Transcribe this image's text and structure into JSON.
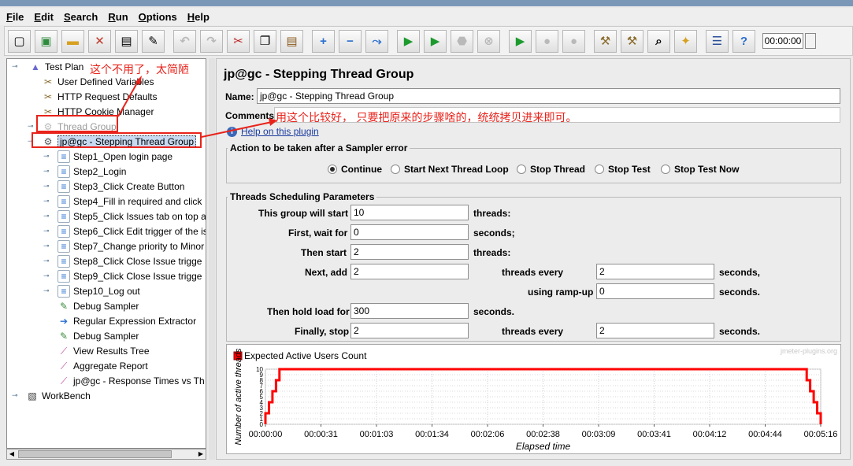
{
  "menu": [
    "File",
    "Edit",
    "Search",
    "Run",
    "Options",
    "Help"
  ],
  "toolbar": {
    "icons": [
      "new-icon",
      "templates-icon",
      "open-icon",
      "close-icon",
      "save-icon",
      "save-screenshot-icon",
      "undo-icon",
      "redo-icon",
      "cut-icon",
      "copy-icon",
      "paste-icon",
      "expand-icon",
      "collapse-icon",
      "toggle-icon",
      "start-icon",
      "start-no-pause-icon",
      "stop-icon",
      "shutdown-icon",
      "remote-start-icon",
      "remote-stop-icon",
      "remote-shutdown-icon",
      "clear-icon",
      "clear-all-icon",
      "search-icon",
      "reset-search-icon",
      "function-helper-icon",
      "help-icon"
    ],
    "timer": "00:00:00"
  },
  "tree": {
    "items": [
      {
        "label": "Test Plan",
        "icon": "test-plan-icon"
      },
      {
        "label": "User Defined Variables",
        "icon": "config-wrench-icon"
      },
      {
        "label": "HTTP Request Defaults",
        "icon": "config-wrench-icon"
      },
      {
        "label": "HTTP Cookie Manager",
        "icon": "config-wrench-icon"
      },
      {
        "label": "Thread Group",
        "icon": "thread-group-icon"
      },
      {
        "label": "jp@gc - Stepping Thread Group",
        "icon": "thread-group-icon"
      },
      {
        "label": "Step1_Open login page",
        "icon": "transaction-controller-icon"
      },
      {
        "label": "Step2_Login",
        "icon": "transaction-controller-icon"
      },
      {
        "label": "Step3_Click Create Button",
        "icon": "transaction-controller-icon"
      },
      {
        "label": "Step4_Fill in required and click",
        "icon": "transaction-controller-icon"
      },
      {
        "label": "Step5_Click Issues tab on top a",
        "icon": "transaction-controller-icon"
      },
      {
        "label": "Step6_Click Edit trigger of the is",
        "icon": "transaction-controller-icon"
      },
      {
        "label": "Step7_Change priority to Minor",
        "icon": "transaction-controller-icon"
      },
      {
        "label": "Step8_Click Close Issue trigge",
        "icon": "transaction-controller-icon"
      },
      {
        "label": "Step9_Click Close Issue trigge",
        "icon": "transaction-controller-icon"
      },
      {
        "label": "Step10_Log out",
        "icon": "transaction-controller-icon"
      },
      {
        "label": "Debug Sampler",
        "icon": "sampler-pen-icon"
      },
      {
        "label": "Regular Expression Extractor",
        "icon": "post-processor-icon"
      },
      {
        "label": "Debug Sampler",
        "icon": "sampler-pen-icon"
      },
      {
        "label": "View Results Tree",
        "icon": "listener-graph-icon"
      },
      {
        "label": "Aggregate Report",
        "icon": "listener-graph-icon"
      },
      {
        "label": "jp@gc - Response Times vs Th",
        "icon": "listener-graph-icon"
      },
      {
        "label": "WorkBench",
        "icon": "workbench-icon"
      }
    ]
  },
  "panel": {
    "title": "jp@gc - Stepping Thread Group",
    "name_label": "Name:",
    "name_value": "jp@gc - Stepping Thread Group",
    "comments_label": "Comments:",
    "help_link": "Help on this plugin",
    "error_action": {
      "legend": "Action to be taken after a Sampler error",
      "options": [
        "Continue",
        "Start Next Thread Loop",
        "Stop Thread",
        "Stop Test",
        "Stop Test Now"
      ],
      "selected": "Continue"
    },
    "schedule": {
      "legend": "Threads Scheduling Parameters",
      "this_group_label": "This group will start",
      "this_group_value": "10",
      "threads_unit": "threads:",
      "first_wait_label": "First, wait for",
      "first_wait_value": "0",
      "seconds_unit": "seconds;",
      "then_start_label": "Then start",
      "then_start_value": "2",
      "next_add_label": "Next, add",
      "next_add_value": "2",
      "threads_every_label": "threads every",
      "next_every_value": "2",
      "seconds_comma": "seconds,",
      "ramp_label": "using ramp-up",
      "ramp_value": "0",
      "seconds_dot": "seconds.",
      "hold_label": "Then hold load for",
      "hold_value": "300",
      "finally_label": "Finally, stop",
      "finally_value": "2",
      "finally_every_value": "2"
    }
  },
  "annotations": {
    "top": "这个不用了，太简陋",
    "middle": "用这个比较好，   只要把原来的步骤啥的，统统拷贝进来即可。"
  },
  "chart_data": {
    "type": "line",
    "legend": "Expected Active Users Count",
    "watermark": "jmeter-plugins.org",
    "xlabel": "Elapsed time",
    "ylabel": "Number of active threads",
    "ytick_labels": [
      "0",
      "1",
      "2",
      "3",
      "4",
      "5",
      "6",
      "7",
      "8",
      "9",
      "10"
    ],
    "xtick_labels": [
      "00:00:00",
      "00:00:31",
      "00:01:03",
      "00:01:34",
      "00:02:06",
      "00:02:38",
      "00:03:09",
      "00:03:41",
      "00:04:12",
      "00:04:44",
      "00:05:16"
    ],
    "xlim_seconds": [
      0,
      316
    ],
    "ylim": [
      0,
      10
    ],
    "color": "#ff0000",
    "points": [
      [
        0,
        0
      ],
      [
        0,
        2
      ],
      [
        2,
        2
      ],
      [
        2,
        4
      ],
      [
        4,
        4
      ],
      [
        4,
        6
      ],
      [
        6,
        6
      ],
      [
        6,
        8
      ],
      [
        8,
        8
      ],
      [
        8,
        10
      ],
      [
        308,
        10
      ],
      [
        308,
        8
      ],
      [
        310,
        8
      ],
      [
        310,
        6
      ],
      [
        312,
        6
      ],
      [
        312,
        4
      ],
      [
        314,
        4
      ],
      [
        314,
        2
      ],
      [
        316,
        2
      ],
      [
        316,
        0
      ]
    ]
  }
}
